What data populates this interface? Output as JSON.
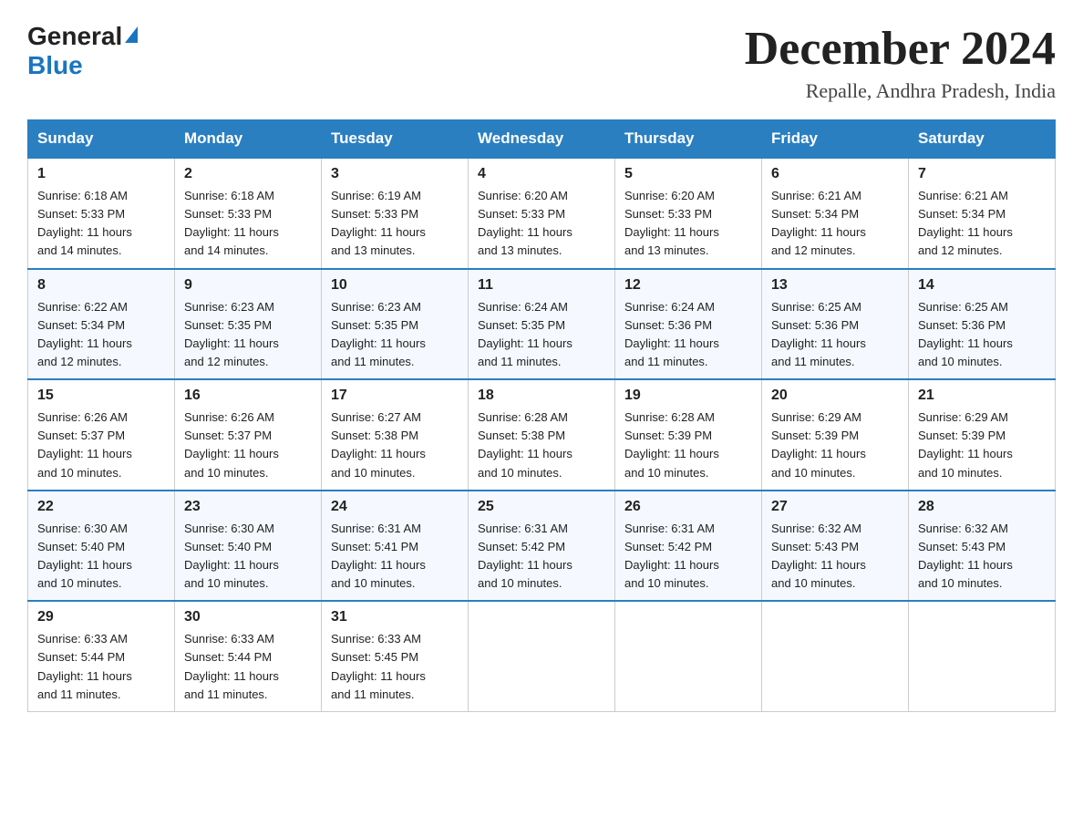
{
  "logo": {
    "general": "General",
    "blue": "Blue"
  },
  "title": "December 2024",
  "subtitle": "Repalle, Andhra Pradesh, India",
  "days": [
    "Sunday",
    "Monday",
    "Tuesday",
    "Wednesday",
    "Thursday",
    "Friday",
    "Saturday"
  ],
  "weeks": [
    [
      {
        "day": "1",
        "sunrise": "6:18 AM",
        "sunset": "5:33 PM",
        "daylight": "11 hours and 14 minutes."
      },
      {
        "day": "2",
        "sunrise": "6:18 AM",
        "sunset": "5:33 PM",
        "daylight": "11 hours and 14 minutes."
      },
      {
        "day": "3",
        "sunrise": "6:19 AM",
        "sunset": "5:33 PM",
        "daylight": "11 hours and 13 minutes."
      },
      {
        "day": "4",
        "sunrise": "6:20 AM",
        "sunset": "5:33 PM",
        "daylight": "11 hours and 13 minutes."
      },
      {
        "day": "5",
        "sunrise": "6:20 AM",
        "sunset": "5:33 PM",
        "daylight": "11 hours and 13 minutes."
      },
      {
        "day": "6",
        "sunrise": "6:21 AM",
        "sunset": "5:34 PM",
        "daylight": "11 hours and 12 minutes."
      },
      {
        "day": "7",
        "sunrise": "6:21 AM",
        "sunset": "5:34 PM",
        "daylight": "11 hours and 12 minutes."
      }
    ],
    [
      {
        "day": "8",
        "sunrise": "6:22 AM",
        "sunset": "5:34 PM",
        "daylight": "11 hours and 12 minutes."
      },
      {
        "day": "9",
        "sunrise": "6:23 AM",
        "sunset": "5:35 PM",
        "daylight": "11 hours and 12 minutes."
      },
      {
        "day": "10",
        "sunrise": "6:23 AM",
        "sunset": "5:35 PM",
        "daylight": "11 hours and 11 minutes."
      },
      {
        "day": "11",
        "sunrise": "6:24 AM",
        "sunset": "5:35 PM",
        "daylight": "11 hours and 11 minutes."
      },
      {
        "day": "12",
        "sunrise": "6:24 AM",
        "sunset": "5:36 PM",
        "daylight": "11 hours and 11 minutes."
      },
      {
        "day": "13",
        "sunrise": "6:25 AM",
        "sunset": "5:36 PM",
        "daylight": "11 hours and 11 minutes."
      },
      {
        "day": "14",
        "sunrise": "6:25 AM",
        "sunset": "5:36 PM",
        "daylight": "11 hours and 10 minutes."
      }
    ],
    [
      {
        "day": "15",
        "sunrise": "6:26 AM",
        "sunset": "5:37 PM",
        "daylight": "11 hours and 10 minutes."
      },
      {
        "day": "16",
        "sunrise": "6:26 AM",
        "sunset": "5:37 PM",
        "daylight": "11 hours and 10 minutes."
      },
      {
        "day": "17",
        "sunrise": "6:27 AM",
        "sunset": "5:38 PM",
        "daylight": "11 hours and 10 minutes."
      },
      {
        "day": "18",
        "sunrise": "6:28 AM",
        "sunset": "5:38 PM",
        "daylight": "11 hours and 10 minutes."
      },
      {
        "day": "19",
        "sunrise": "6:28 AM",
        "sunset": "5:39 PM",
        "daylight": "11 hours and 10 minutes."
      },
      {
        "day": "20",
        "sunrise": "6:29 AM",
        "sunset": "5:39 PM",
        "daylight": "11 hours and 10 minutes."
      },
      {
        "day": "21",
        "sunrise": "6:29 AM",
        "sunset": "5:39 PM",
        "daylight": "11 hours and 10 minutes."
      }
    ],
    [
      {
        "day": "22",
        "sunrise": "6:30 AM",
        "sunset": "5:40 PM",
        "daylight": "11 hours and 10 minutes."
      },
      {
        "day": "23",
        "sunrise": "6:30 AM",
        "sunset": "5:40 PM",
        "daylight": "11 hours and 10 minutes."
      },
      {
        "day": "24",
        "sunrise": "6:31 AM",
        "sunset": "5:41 PM",
        "daylight": "11 hours and 10 minutes."
      },
      {
        "day": "25",
        "sunrise": "6:31 AM",
        "sunset": "5:42 PM",
        "daylight": "11 hours and 10 minutes."
      },
      {
        "day": "26",
        "sunrise": "6:31 AM",
        "sunset": "5:42 PM",
        "daylight": "11 hours and 10 minutes."
      },
      {
        "day": "27",
        "sunrise": "6:32 AM",
        "sunset": "5:43 PM",
        "daylight": "11 hours and 10 minutes."
      },
      {
        "day": "28",
        "sunrise": "6:32 AM",
        "sunset": "5:43 PM",
        "daylight": "11 hours and 10 minutes."
      }
    ],
    [
      {
        "day": "29",
        "sunrise": "6:33 AM",
        "sunset": "5:44 PM",
        "daylight": "11 hours and 11 minutes."
      },
      {
        "day": "30",
        "sunrise": "6:33 AM",
        "sunset": "5:44 PM",
        "daylight": "11 hours and 11 minutes."
      },
      {
        "day": "31",
        "sunrise": "6:33 AM",
        "sunset": "5:45 PM",
        "daylight": "11 hours and 11 minutes."
      },
      null,
      null,
      null,
      null
    ]
  ],
  "labels": {
    "sunrise": "Sunrise:",
    "sunset": "Sunset:",
    "daylight": "Daylight:"
  }
}
